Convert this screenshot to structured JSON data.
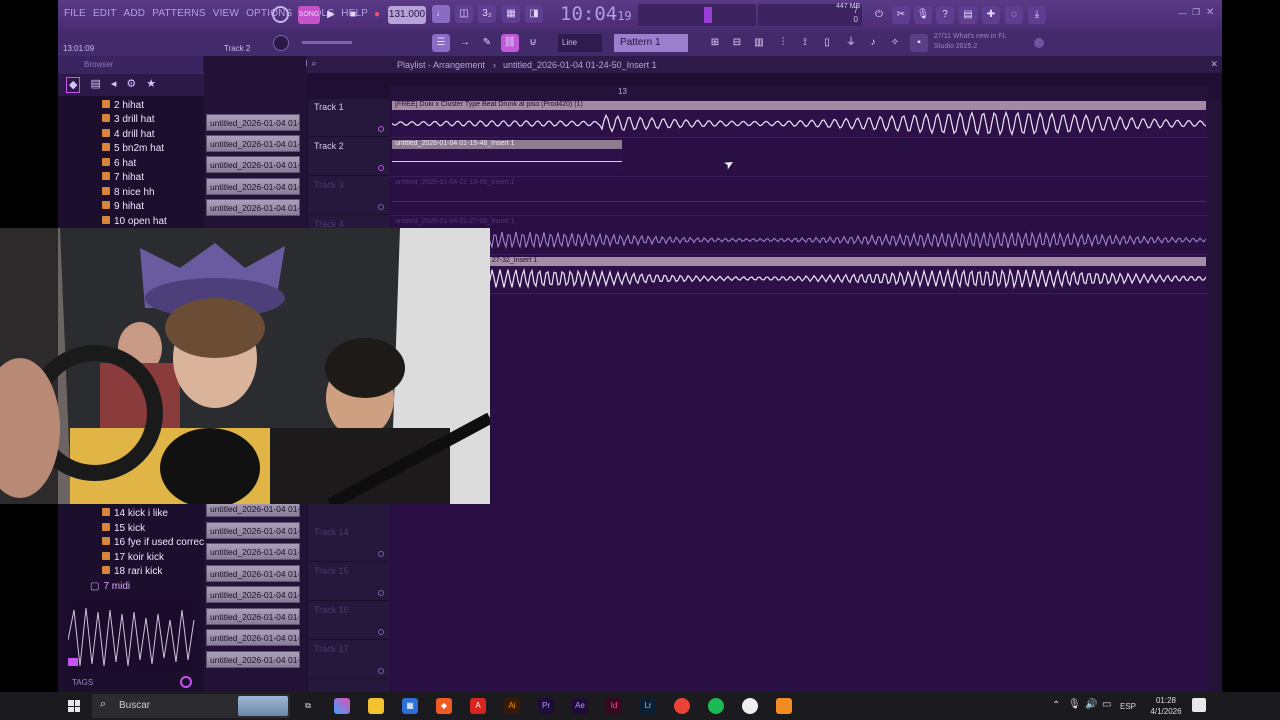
{
  "menu": [
    "FILE",
    "EDIT",
    "ADD",
    "PATTERNS",
    "VIEW",
    "OPTIONS",
    "TOOLS",
    "HELP"
  ],
  "transport": {
    "tempo": "131.000",
    "song_pos": "10:04",
    "song_pos_small": "19",
    "mode_badge": "SONG"
  },
  "hint_bar": {
    "time": "13:01:09",
    "track": "Track 2"
  },
  "memory": {
    "value": "447 MB",
    "cpu_left": "7",
    "cpu_right": "0"
  },
  "pattern": {
    "label": "Pattern 1",
    "snap": "Line"
  },
  "news": {
    "line1": "27/11 What's new in FL",
    "line2": "Studio 2025.2"
  },
  "browser": {
    "title": "Browser",
    "items_top": [
      "2 hihat",
      "3 drill hat",
      "4 drill hat",
      "5 bn2m hat",
      "6 hat",
      "7 hihat",
      "8 nice hh",
      "9 hihat",
      "10 open hat"
    ],
    "items_bottom": [
      "14 kick i like",
      "15 kick",
      "16 fye if used correctly",
      "17 koir kick",
      "18 rari kick"
    ],
    "folder": "7 midi",
    "footer": "TAGS"
  },
  "playlist": {
    "title": "Playlist - Arrangement",
    "crumb": "untitled_2026-01-04 01-24-50_Insert 1",
    "ruler_mark": "13"
  },
  "clip_list": [
    "untitled_2026-01-04 01-",
    "untitled_2026-01-04 01-",
    "untitled_2026-01-04 01-",
    "untitled_2026-01-04 01-",
    "untitled_2026-01-04 01-",
    "untitled_2026-01-04 01-",
    "untitled_2026-01-04 01-",
    "untitled_2026-01-04 01-",
    "untitled_2026-01-04 01-",
    "untitled_2026-01-04 01-",
    "untitled_2026-01-04 01-",
    "untitled_2026-01-04 01-",
    "untitled_2026-01-04 01-"
  ],
  "tracks": [
    {
      "name": "Track 1"
    },
    {
      "name": "Track 2"
    },
    {
      "name": "Track 3"
    },
    {
      "name": "Track 4"
    },
    {
      "name": "Track 14"
    },
    {
      "name": "Track 15"
    },
    {
      "name": "Track 16"
    },
    {
      "name": "Track 17"
    }
  ],
  "clips": {
    "c1": "[FREE] Duki x Cluster Type Beat Drunk al piso (Prod420) (1)",
    "c2": "untitled_2026-01-04 01-15-48_Insert 1",
    "c3": "untitled_2026-01-04 01-19-56_Insert 1",
    "c4": "untitled_2026-01-04 01-27-06_Insert 1",
    "c5": "27-32_Insert 1"
  },
  "taskbar": {
    "search_placeholder": "Buscar",
    "time": "01:28",
    "date": "4/1/2026",
    "lang": "ESP"
  },
  "colors": {
    "accent": "#8a5cd6",
    "playlist_bg": "#2a0f44",
    "clip_header": "#a58aa0",
    "wave": "#e6e0ee"
  }
}
